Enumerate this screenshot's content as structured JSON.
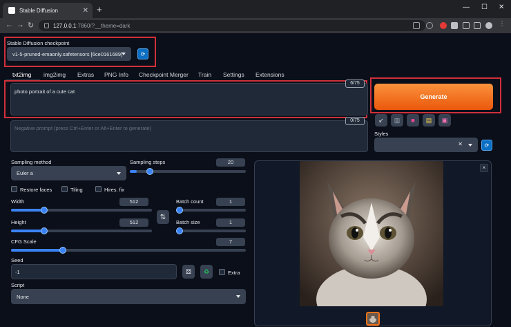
{
  "browser": {
    "tab_title": "Stable Diffusion",
    "tab_close": "✕",
    "new_tab": "+",
    "url_host": "127.0.0.1",
    "url_rest": ":7860/?__theme=dark"
  },
  "checkpoint": {
    "label": "Stable Diffusion checkpoint",
    "value": "v1-5-pruned-emaonly.safetensors [6ce0161689]"
  },
  "tabs": [
    "txt2img",
    "img2img",
    "Extras",
    "PNG Info",
    "Checkpoint Merger",
    "Train",
    "Settings",
    "Extensions"
  ],
  "prompt": {
    "text": "photo portrait of a cute cat",
    "counter": "6/75",
    "negative_placeholder": "Negative prompt (press Ctrl+Enter or Alt+Enter to generate)",
    "negative_counter": "0/75"
  },
  "generate_label": "Generate",
  "styles_label": "Styles",
  "sampling": {
    "method_label": "Sampling method",
    "method_value": "Euler a",
    "steps_label": "Sampling steps",
    "steps_value": "20"
  },
  "options": {
    "restore_faces": "Restore faces",
    "tiling": "Tiling",
    "hires_fix": "Hires. fix"
  },
  "size": {
    "width_label": "Width",
    "width_value": "512",
    "height_label": "Height",
    "height_value": "512",
    "swap_icon": "⇅"
  },
  "batch": {
    "count_label": "Batch count",
    "count_value": "1",
    "size_label": "Batch size",
    "size_value": "1"
  },
  "cfg": {
    "label": "CFG Scale",
    "value": "7"
  },
  "seed": {
    "label": "Seed",
    "value": "-1",
    "extra_label": "Extra"
  },
  "script": {
    "label": "Script",
    "value": "None"
  },
  "output": {
    "close": "×"
  },
  "colors": {
    "accent": "#ea580c",
    "background": "#0b0f19",
    "highlight": "#d0303a"
  }
}
